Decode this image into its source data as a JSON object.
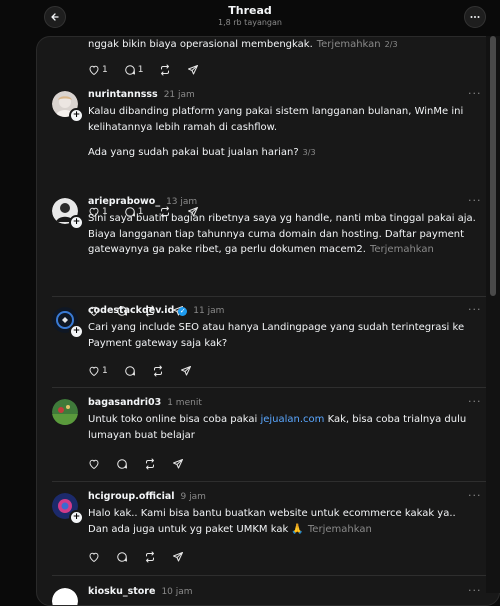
{
  "header": {
    "title": "Thread",
    "views": "1,8 rb tayangan"
  },
  "top_fragment": {
    "text": "nggak bikin biaya operasional membengkak.",
    "translate": "Terjemahkan",
    "page": "2/3",
    "likes": "1",
    "replies": "1"
  },
  "posts": [
    {
      "username": "nurintannsss",
      "time": "21 jam",
      "verified": false,
      "lines": [
        "Kalau dibanding platform yang pakai sistem langganan bulanan, WinMe ini",
        "kelihatannya lebih ramah di cashflow."
      ],
      "line2": "Ada yang sudah pakai buat jualan harian?",
      "page": "3/3",
      "likes": "1",
      "replies": "1"
    },
    {
      "username": "arieprabowo_",
      "time": "13 jam",
      "verified": false,
      "lines": [
        "Sini saya buatin bagian ribetnya saya yg handle, nanti mba tinggal pakai aja.",
        "Biaya langganan tiap tahunnya cuma domain dan hosting. Daftar payment",
        "gatewaynya ga pake ribet, ga perlu dokumen macem2."
      ],
      "translate": "Terjemahkan",
      "likes": "",
      "replies": ""
    },
    {
      "username": "codestackdev.id",
      "time": "11 jam",
      "verified": true,
      "lines": [
        "Cari yang include SEO atau hanya Landingpage yang sudah terintegrasi ke",
        "Payment gateway saja kak?"
      ],
      "likes": "1",
      "replies": ""
    },
    {
      "username": "bagasandri03",
      "time": "1 menit",
      "verified": false,
      "text_before": "Untuk toko online bisa coba pakai ",
      "link": "jejualan.com",
      "text_after": " Kak, bisa coba trialnya dulu",
      "line2": "lumayan buat belajar",
      "likes": "",
      "replies": ""
    },
    {
      "username": "hcigroup.official",
      "time": "9 jam",
      "verified": false,
      "lines": [
        "Halo kak.. Kami bisa bantu buatkan website untuk ecommerce kakak ya..",
        "Dan ada juga untuk yg paket UMKM kak 🙏"
      ],
      "translate": "Terjemahkan",
      "likes": "",
      "replies": ""
    },
    {
      "username": "kiosku_store",
      "time": "10 jam",
      "verified": false
    }
  ],
  "colors": {
    "background": "#0a0a0a",
    "panel": "#181818",
    "text": "#f3f5f7",
    "muted": "#8a8a8a",
    "link": "#5aa7ff",
    "verified": "#1d9bf0"
  },
  "icons": [
    "back-arrow-icon",
    "more-icon",
    "heart-icon",
    "comment-icon",
    "repost-icon",
    "share-icon",
    "plus-icon",
    "verified-icon"
  ]
}
